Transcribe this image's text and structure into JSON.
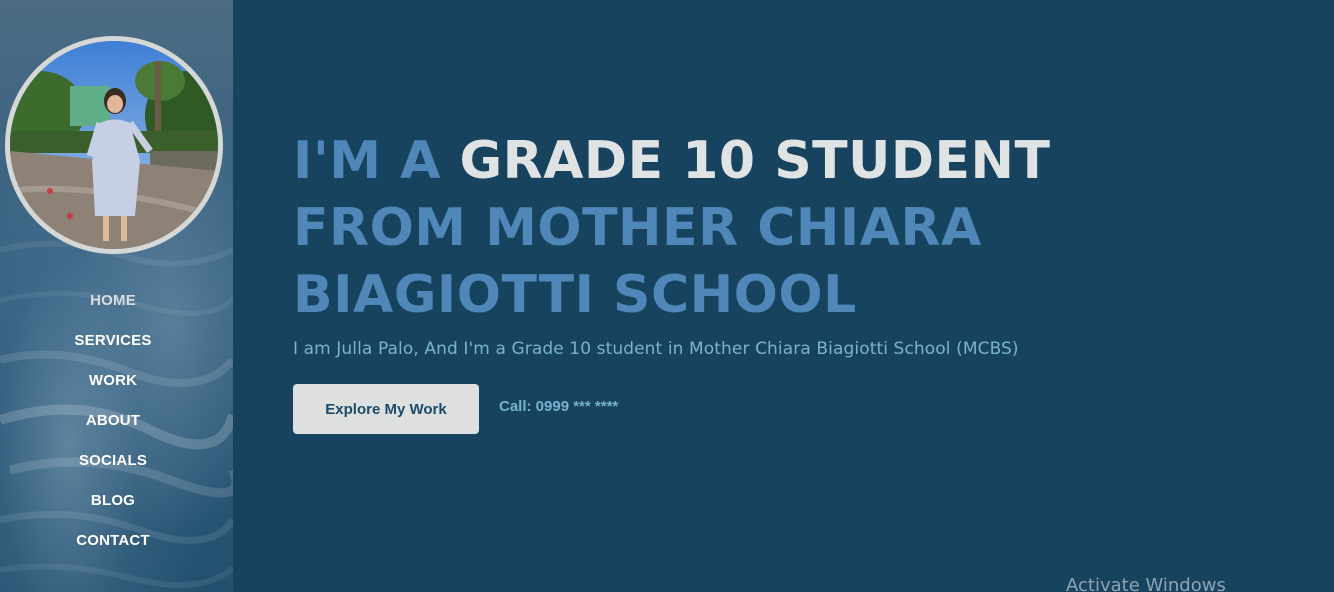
{
  "sidebar": {
    "nav": [
      {
        "label": "HOME"
      },
      {
        "label": "SERVICES"
      },
      {
        "label": "WORK"
      },
      {
        "label": "ABOUT"
      },
      {
        "label": "SOCIALS"
      },
      {
        "label": "BLOG"
      },
      {
        "label": "CONTACT"
      }
    ]
  },
  "hero": {
    "headline_prefix": "I'M A ",
    "headline_highlight": "GRADE 10 STUDENT",
    "headline_line2": "FROM MOTHER CHIARA",
    "headline_line3": "BIAGIOTTI SCHOOL",
    "subtitle": "I am Julla Palo, And I'm a Grade 10 student in Mother Chiara Biagiotti School (MCBS)",
    "cta_label": "Explore My Work",
    "call_text": "Call: 0999 *** ****"
  },
  "watermark": "Activate Windows",
  "colors": {
    "background": "#17435e",
    "accent_blue": "#4f88b8",
    "highlight": "#dfe3e4",
    "subtitle": "#79b3cc",
    "button_bg": "#dde0de",
    "button_text": "#1c4a68"
  }
}
